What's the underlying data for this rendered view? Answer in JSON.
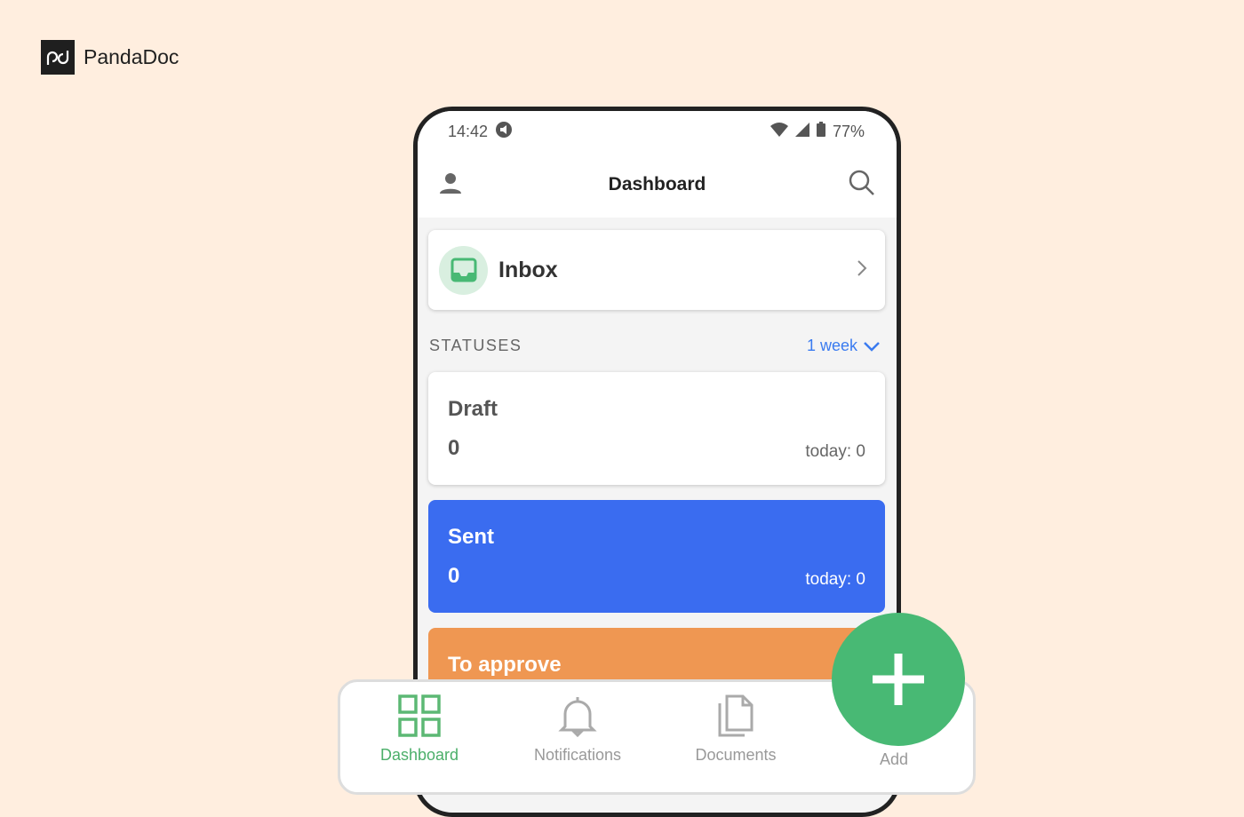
{
  "brand": {
    "name": "PandaDoc"
  },
  "status_bar": {
    "time": "14:42",
    "battery": "77%"
  },
  "header": {
    "title": "Dashboard"
  },
  "inbox": {
    "label": "Inbox"
  },
  "statuses": {
    "label": "STATUSES",
    "period": "1 week",
    "items": [
      {
        "name": "Draft",
        "count": "0",
        "today": "today: 0",
        "color": "#ffffff"
      },
      {
        "name": "Sent",
        "count": "0",
        "today": "today: 0",
        "color": "#3a6cf0"
      },
      {
        "name": "To approve",
        "color": "#ef9752"
      }
    ]
  },
  "nav": {
    "items": [
      {
        "label": "Dashboard",
        "active": true
      },
      {
        "label": "Notifications"
      },
      {
        "label": "Documents"
      },
      {
        "label": "Add"
      }
    ]
  },
  "colors": {
    "accent": "#48b974",
    "blue": "#3a6cf0",
    "orange": "#ef9752"
  }
}
